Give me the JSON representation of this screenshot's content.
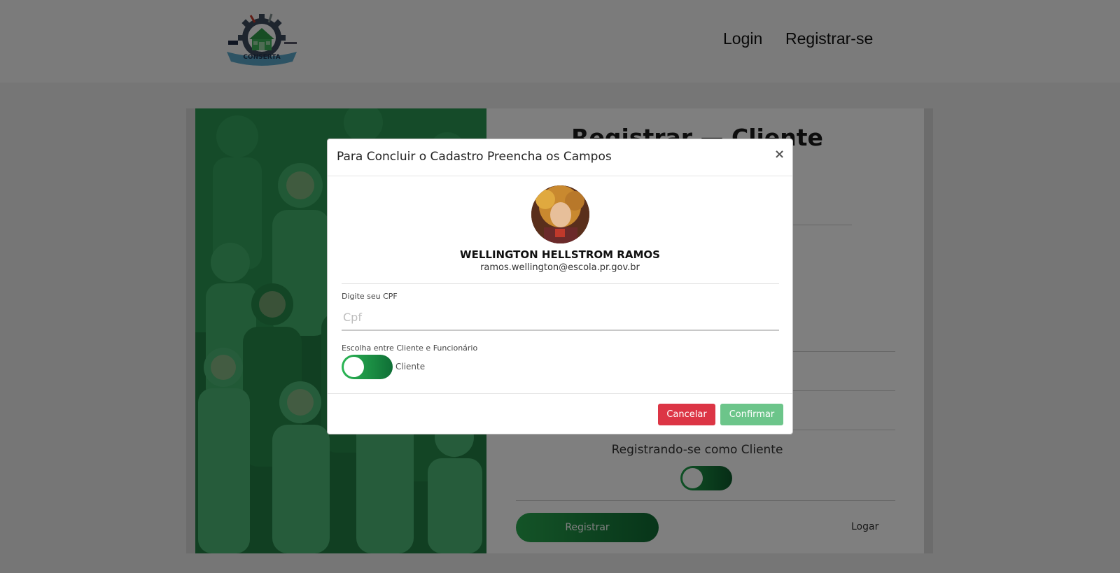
{
  "navbar": {
    "logo_text": "CONSERTA",
    "links": [
      {
        "label": "Login"
      },
      {
        "label": "Registrar-se"
      }
    ]
  },
  "form": {
    "title": "Registrar — Cliente",
    "registering_as": "Registrando-se como Cliente",
    "register_button": "Registrar",
    "login_link": "Logar"
  },
  "modal": {
    "title": "Para Concluir o Cadastro Preencha os Campos",
    "close_symbol": "×",
    "user": {
      "name": "WELLINGTON HELLSTROM RAMOS",
      "email": "ramos.wellington@escola.pr.gov.br"
    },
    "cpf": {
      "label": "Digite seu CPF",
      "placeholder": "Cpf",
      "value": ""
    },
    "role": {
      "label": "Escolha entre Cliente e Funcionário",
      "toggle_text": "Cliente"
    },
    "cancel_button": "Cancelar",
    "confirm_button": "Confirmar"
  },
  "colors": {
    "accent_green": "#1fa24c",
    "danger": "#dc3545",
    "confirm": "#6cc58a"
  }
}
